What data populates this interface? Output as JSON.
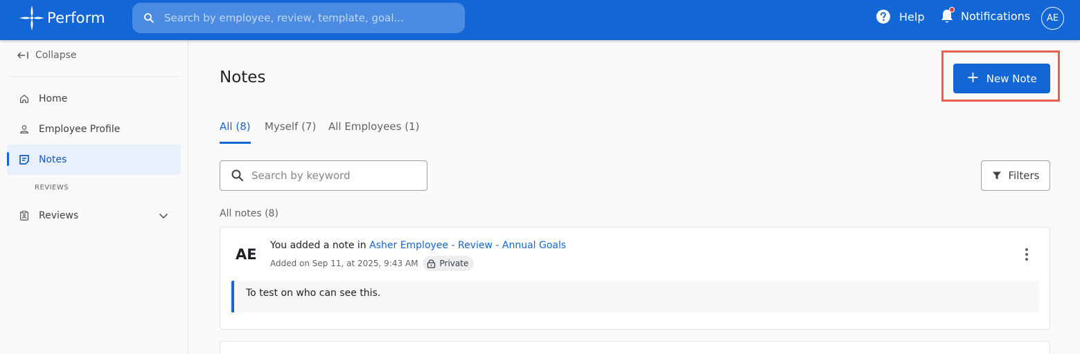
{
  "header": {
    "app_name": "Perform",
    "search_placeholder": "Search by employee, review, template, goal...",
    "help_label": "Help",
    "notifications_label": "Notifications",
    "avatar_initials": "AE",
    "brand_color": "#1366d6"
  },
  "sidebar": {
    "collapse_label": "Collapse",
    "items": [
      {
        "label": "Home",
        "icon": "home-icon"
      },
      {
        "label": "Employee Profile",
        "icon": "person-icon"
      },
      {
        "label": "Notes",
        "icon": "notes-icon",
        "active": true
      }
    ],
    "section_label": "REVIEWS",
    "reviews_label": "Reviews"
  },
  "main": {
    "title": "Notes",
    "new_note_label": "New Note",
    "tabs": [
      {
        "label": "All (8)",
        "active": true
      },
      {
        "label": "Myself (7)"
      },
      {
        "label": "All Employees (1)"
      }
    ],
    "search_placeholder": "Search by keyword",
    "filters_label": "Filters",
    "all_notes_label": "All notes (8)",
    "notes": [
      {
        "initials": "AE",
        "headline_prefix": "You added a note in ",
        "link_text": "Asher Employee - Review - Annual Goals",
        "added_on": "Added on Sep 11, at 2025, 9:43 AM",
        "visibility": "Private",
        "body": "To test on who can see this."
      }
    ]
  }
}
